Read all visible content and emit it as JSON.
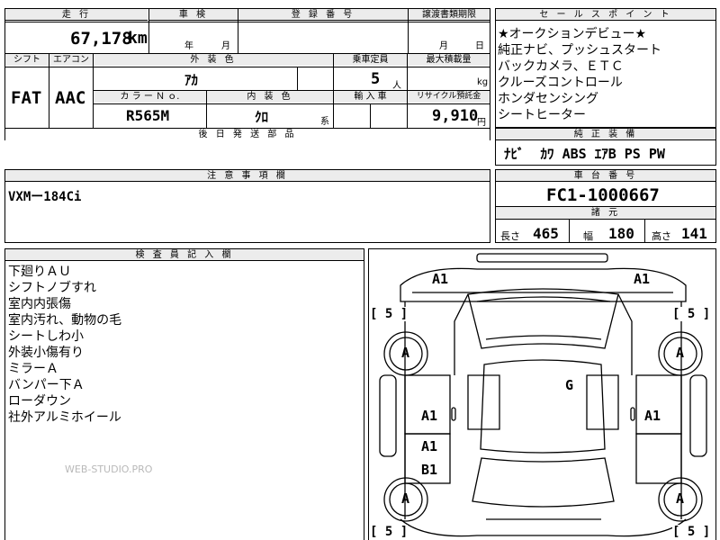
{
  "top_table": {
    "headers": {
      "mileage": "走 行",
      "inspection": "車 検",
      "registration": "登 録 番 号",
      "transfer_deadline": "譲渡書類期限",
      "shift": "シフト",
      "aircon": "エアコン",
      "exterior_color": "外 装 色",
      "capacity": "乗車定員",
      "max_load": "最大積載量",
      "color_no": "カ ラ ー Ｎ ｏ.",
      "interior_color": "内 装 色",
      "import": "輸 入 車",
      "recycle_fee": "リサイクル預託金",
      "later_parts": "後 日 発 送 部 品"
    },
    "values": {
      "mileage": "67,178",
      "mileage_unit": "km",
      "inspection_year_unit": "年",
      "inspection_month_unit": "月",
      "transfer_month_unit": "月",
      "transfer_day_unit": "日",
      "shift": "FAT",
      "aircon": "AAC",
      "exterior_color": "ｱｶ",
      "capacity": "5",
      "capacity_unit": "人",
      "max_load_unit": "kg",
      "color_no": "R565M",
      "interior_color": "ｸﾛ",
      "interior_suffix": "系",
      "recycle_fee": "9,910",
      "recycle_unit": "円"
    }
  },
  "sales_points": {
    "header": "セ ー ル ス ポ イ ン ト",
    "lines": [
      "★オークションデビュー★",
      "純正ナビ、プッシュスタート",
      "バックカメラ、ＥＴＣ",
      "クルーズコントロール",
      "ホンダセンシング",
      "シートヒーター"
    ]
  },
  "factory_equipment": {
    "header": "純 正 装 備",
    "value": "ﾅﾋﾞ  ｶﾜ ABS ｴｱB PS PW"
  },
  "notes": {
    "header": "注 意 事 項 欄",
    "value": "VXMー184Ci"
  },
  "chassis": {
    "header": "車 台 番 号",
    "value": "FC1-1000667"
  },
  "specs": {
    "header": "諸 元",
    "length_label": "長さ",
    "length": "465",
    "width_label": "幅",
    "width": "180",
    "height_label": "高さ",
    "height": "141"
  },
  "inspector": {
    "header": "検 査 員 記 入 欄",
    "lines": [
      "下廻りＡＵ",
      "シフトノブすれ",
      "室内内張傷",
      "室内汚れ、動物の毛",
      "シートしわ小",
      "外装小傷有り",
      "ミラーＡ",
      "バンパー下Ａ",
      "ローダウン",
      "社外アルミホイール"
    ],
    "watermark": "WEB-STUDIO.PRO"
  },
  "diagram": {
    "marks": {
      "front_left_corner": "A1",
      "front_right_corner": "A1",
      "tire_fl": "[ 5 ]",
      "tire_fr": "[ 5 ]",
      "tire_rl": "[ 5 ]",
      "tire_rr": "[ 5 ]",
      "wheel_fl": "A",
      "wheel_fr": "A",
      "wheel_rl": "A",
      "wheel_rr": "A",
      "roof": "G",
      "front_door_left": "A1",
      "front_door_right": "A1",
      "rear_door_left_1": "A1",
      "rear_door_left_2": "B1"
    }
  }
}
